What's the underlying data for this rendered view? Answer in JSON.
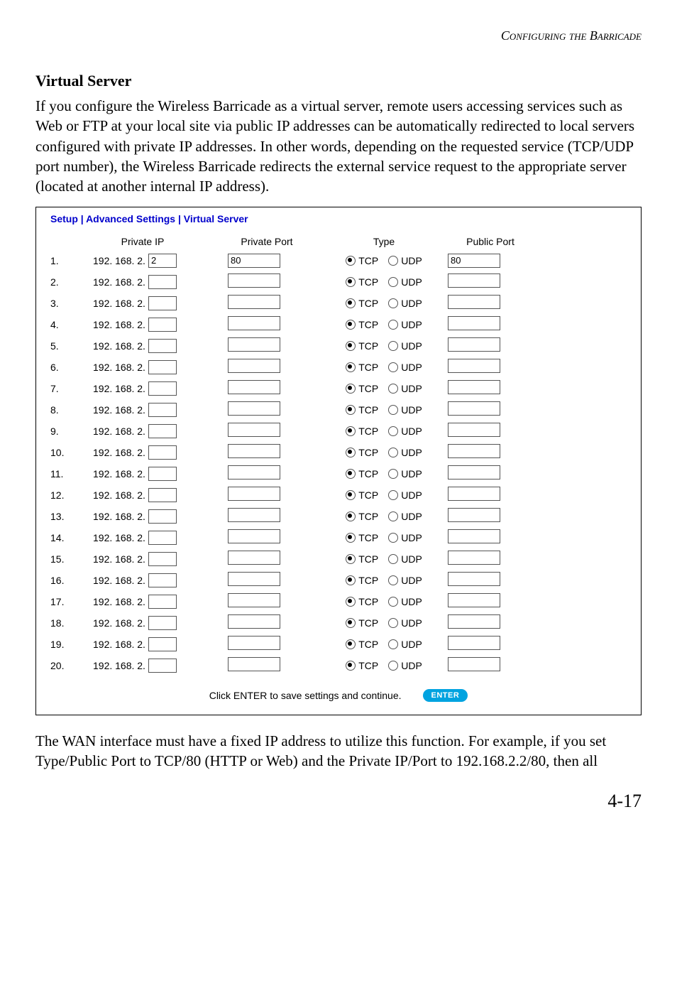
{
  "running_head": "Configuring the Barricade",
  "section_title": "Virtual Server",
  "para1": "If you configure the Wireless Barricade as a virtual server, remote users accessing services such as Web or FTP at your local site via public IP addresses can be automatically redirected to local servers configured with private IP addresses. In other words, depending on the requested service (TCP/UDP port number), the Wireless Barricade redirects the external service request to the appropriate server (located at another internal IP address).",
  "panel_title": "Setup | Advanced Settings | Virtual Server",
  "headers": {
    "private_ip": "Private IP",
    "private_port": "Private Port",
    "type": "Type",
    "public_port": "Public Port"
  },
  "ip_prefix": "192. 168. 2.",
  "tcp_label": "TCP",
  "udp_label": "UDP",
  "rows": [
    {
      "n": "1.",
      "ip": "2",
      "pport": "80",
      "tcp": true,
      "pub": "80"
    },
    {
      "n": "2.",
      "ip": "",
      "pport": "",
      "tcp": true,
      "pub": ""
    },
    {
      "n": "3.",
      "ip": "",
      "pport": "",
      "tcp": true,
      "pub": ""
    },
    {
      "n": "4.",
      "ip": "",
      "pport": "",
      "tcp": true,
      "pub": ""
    },
    {
      "n": "5.",
      "ip": "",
      "pport": "",
      "tcp": true,
      "pub": ""
    },
    {
      "n": "6.",
      "ip": "",
      "pport": "",
      "tcp": true,
      "pub": ""
    },
    {
      "n": "7.",
      "ip": "",
      "pport": "",
      "tcp": true,
      "pub": ""
    },
    {
      "n": "8.",
      "ip": "",
      "pport": "",
      "tcp": true,
      "pub": ""
    },
    {
      "n": "9.",
      "ip": "",
      "pport": "",
      "tcp": true,
      "pub": ""
    },
    {
      "n": "10.",
      "ip": "",
      "pport": "",
      "tcp": true,
      "pub": ""
    },
    {
      "n": "11.",
      "ip": "",
      "pport": "",
      "tcp": true,
      "pub": ""
    },
    {
      "n": "12.",
      "ip": "",
      "pport": "",
      "tcp": true,
      "pub": ""
    },
    {
      "n": "13.",
      "ip": "",
      "pport": "",
      "tcp": true,
      "pub": ""
    },
    {
      "n": "14.",
      "ip": "",
      "pport": "",
      "tcp": true,
      "pub": ""
    },
    {
      "n": "15.",
      "ip": "",
      "pport": "",
      "tcp": true,
      "pub": ""
    },
    {
      "n": "16.",
      "ip": "",
      "pport": "",
      "tcp": true,
      "pub": ""
    },
    {
      "n": "17.",
      "ip": "",
      "pport": "",
      "tcp": true,
      "pub": ""
    },
    {
      "n": "18.",
      "ip": "",
      "pport": "",
      "tcp": true,
      "pub": ""
    },
    {
      "n": "19.",
      "ip": "",
      "pport": "",
      "tcp": true,
      "pub": ""
    },
    {
      "n": "20.",
      "ip": "",
      "pport": "",
      "tcp": true,
      "pub": ""
    }
  ],
  "footer_text": "Click ENTER to save settings and continue.",
  "enter_label": "ENTER",
  "para2": "The WAN interface must have a fixed IP address to utilize this function. For example, if you set Type/Public Port to TCP/80 (HTTP or Web) and the Private IP/Port to 192.168.2.2/80, then all",
  "page_number": "4-17"
}
